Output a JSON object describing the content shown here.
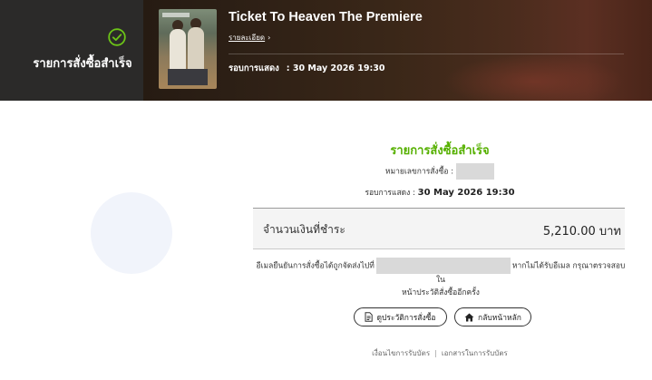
{
  "header": {
    "status_label": "รายการสั่งซื้อสำเร็จ",
    "event_title": "Ticket To Heaven The Premiere",
    "detail_link": "รายละเอียด",
    "showtime_label": "รอบการแสดง",
    "showtime_value": ": 30 May 2026 19:30"
  },
  "order": {
    "success_title": "รายการสั่งซื้อสำเร็จ",
    "order_number_label": "หมายเลขการสั่งซื้อ :",
    "showtime_label": "รอบการแสดง :",
    "showtime_value": "30 May 2026 19:30",
    "amount_label": "จำนวนเงินที่ชำระ",
    "amount_value": "5,210.00 บาท",
    "email_note_before": "อีเมลยืนยันการสั่งซื้อได้ถูกจัดส่งไปที่",
    "email_note_after": "หากไม่ได้รับอีเมล กรุณาตรวจสอบใน",
    "email_note_line2": "หน้าประวัติสั่งซื้ออีกครั้ง"
  },
  "actions": {
    "history_button": "ดูประวัติการสั่งซื้อ",
    "home_button": "กลับหน้าหลัก"
  },
  "footer": {
    "terms_link": "เงื่อนไขการรับบัตร",
    "separator": "|",
    "documents_link": "เอกสารในการรับบัตร"
  },
  "colors": {
    "accent_green": "#56b000",
    "status_panel": "#2b2a29"
  },
  "icons": {
    "status": "check-circle-icon",
    "detail": "chevron-right-icon",
    "history": "document-icon",
    "home": "home-icon"
  }
}
